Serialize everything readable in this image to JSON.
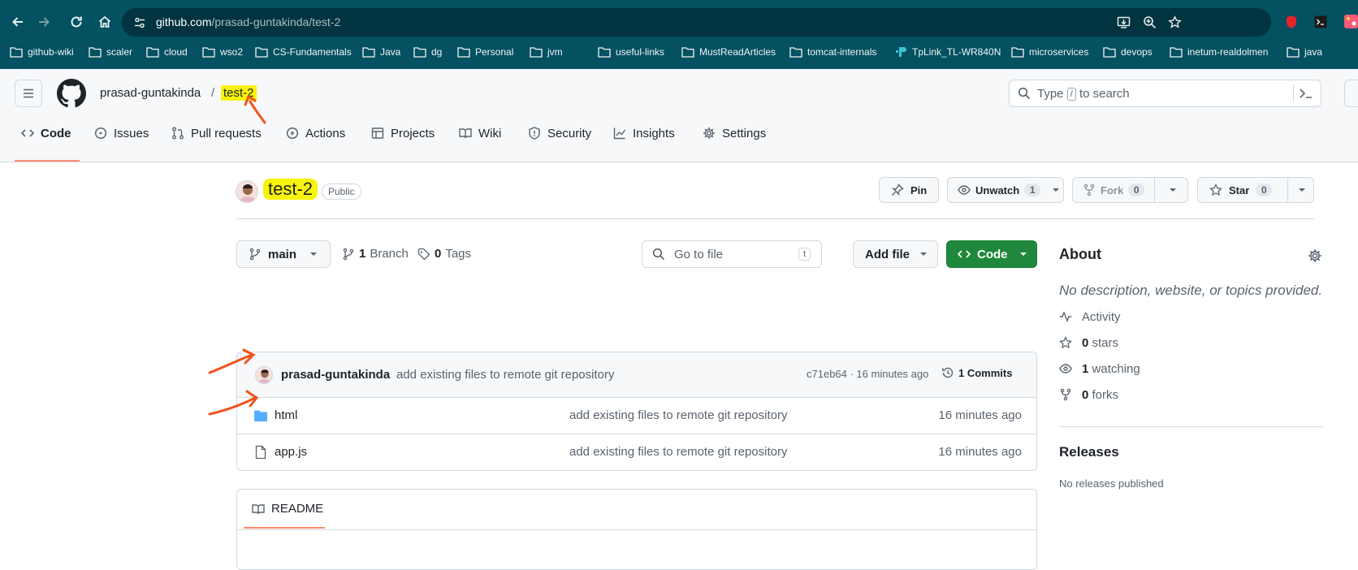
{
  "browser": {
    "url_host": "github.com",
    "url_path": "/prasad-guntakinda/test-2",
    "bookmarks": [
      "github-wiki",
      "scaler",
      "cloud",
      "wso2",
      "CS-Fundamentals",
      "Java",
      "dg",
      "Personal",
      "jvm",
      "useful-links",
      "MustReadArticles",
      "tomcat-internals",
      "TpLink_TL-WR840N",
      "microservices",
      "devops",
      "inetum-realdolmen",
      "java"
    ]
  },
  "header": {
    "owner": "prasad-guntakinda",
    "separator": "/",
    "repo": "test-2",
    "search_placeholder_pre": "Type",
    "search_key": "/",
    "search_placeholder_post": "to search"
  },
  "tabs": [
    "Code",
    "Issues",
    "Pull requests",
    "Actions",
    "Projects",
    "Wiki",
    "Security",
    "Insights",
    "Settings"
  ],
  "repo": {
    "name": "test-2",
    "visibility": "Public",
    "pin": "Pin",
    "watch": "Unwatch",
    "watch_count": "1",
    "fork": "Fork",
    "fork_count": "0",
    "star": "Star",
    "star_count": "0"
  },
  "toolbar": {
    "branch": "main",
    "branches_count": "1",
    "branches_label": "Branch",
    "tags_count": "0",
    "tags_label": "Tags",
    "goto_placeholder": "Go to file",
    "goto_key": "t",
    "add_file": "Add file",
    "code": "Code"
  },
  "commit": {
    "author": "prasad-guntakinda",
    "message": "add existing files to remote git repository",
    "hash_time": "c71eb64 · 16 minutes ago",
    "commits": "1 Commits"
  },
  "files": [
    {
      "name": "html",
      "type": "folder",
      "message": "add existing files to remote git repository",
      "time": "16 minutes ago"
    },
    {
      "name": "app.js",
      "type": "file",
      "message": "add existing files to remote git repository",
      "time": "16 minutes ago"
    }
  ],
  "readme": {
    "label": "README"
  },
  "about": {
    "title": "About",
    "description": "No description, website, or topics provided.",
    "activity": "Activity",
    "stars_count": "0",
    "stars_label": "stars",
    "watching_count": "1",
    "watching_label": "watching",
    "forks_count": "0",
    "forks_label": "forks",
    "releases_title": "Releases",
    "releases_text": "No releases published"
  },
  "colors": {
    "chrome": "#035161",
    "code_button": "#1f883d",
    "highlight": "#f7f30d",
    "annotation": "#f0531c",
    "folder": "#54aeff"
  }
}
